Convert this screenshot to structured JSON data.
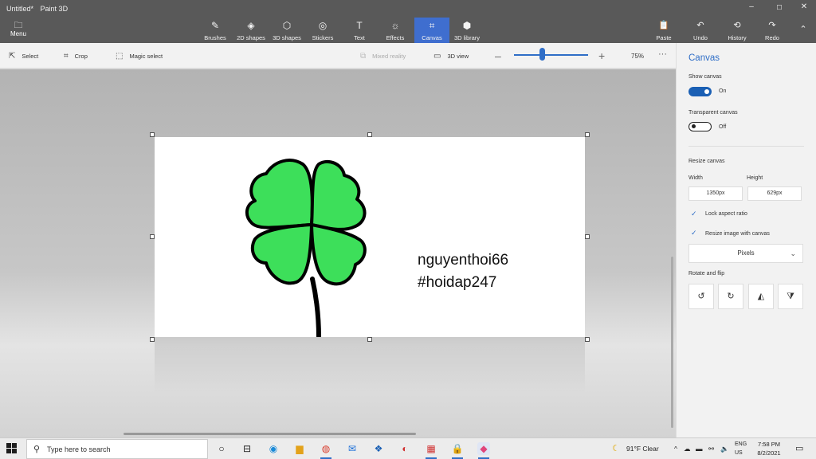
{
  "window": {
    "doc_title": "Untitled*",
    "app_name": "Paint 3D",
    "minimize_glyph": "–",
    "maximize_glyph": "☐",
    "close_glyph": "✕"
  },
  "ribbon": {
    "menu_label": "Menu",
    "tools": [
      {
        "label": "Brushes",
        "icon": "brush-icon",
        "glyph": "✎"
      },
      {
        "label": "2D shapes",
        "icon": "shapes-2d-icon",
        "glyph": "◈"
      },
      {
        "label": "3D shapes",
        "icon": "shapes-3d-icon",
        "glyph": "⬡"
      },
      {
        "label": "Stickers",
        "icon": "sticker-icon",
        "glyph": "◎"
      },
      {
        "label": "Text",
        "icon": "text-icon",
        "glyph": "T"
      },
      {
        "label": "Effects",
        "icon": "effects-icon",
        "glyph": "☼"
      },
      {
        "label": "Canvas",
        "icon": "canvas-icon",
        "glyph": "⌗"
      },
      {
        "label": "3D library",
        "icon": "library-3d-icon",
        "glyph": "⬢"
      }
    ],
    "active_tool": "Canvas",
    "right_tools": [
      {
        "label": "Paste",
        "icon": "paste-icon",
        "glyph": "📋"
      },
      {
        "label": "Undo",
        "icon": "undo-icon",
        "glyph": "↶"
      },
      {
        "label": "History",
        "icon": "history-icon",
        "glyph": "⟲"
      },
      {
        "label": "Redo",
        "icon": "redo-icon",
        "glyph": "↷"
      }
    ],
    "collapse_glyph": "⌃"
  },
  "subtoolbar": {
    "select_label": "Select",
    "crop_label": "Crop",
    "magic_select_label": "Magic select",
    "mixed_reality_label": "Mixed reality",
    "view_3d_label": "3D view",
    "zoom_value": "75%",
    "zoom_level": 0.38,
    "more_glyph": "···"
  },
  "canvas": {
    "line1": "nguyenthoi66",
    "line2": "#hoidap247",
    "clover_color": "#3ddf5a"
  },
  "panel": {
    "title": "Canvas",
    "show_canvas_label": "Show canvas",
    "show_canvas_state": "On",
    "transparent_canvas_label": "Transparent canvas",
    "transparent_canvas_state": "Off",
    "resize_label": "Resize canvas",
    "width_label": "Width",
    "height_label": "Height",
    "width_value": "1350px",
    "height_value": "629px",
    "lock_aspect_label": "Lock aspect ratio",
    "resize_with_canvas_label": "Resize image with canvas",
    "units_value": "Pixels",
    "rotate_flip_label": "Rotate and flip"
  },
  "taskbar": {
    "search_placeholder": "Type here to search",
    "weather": "91°F  Clear",
    "lang_line1": "ENG",
    "lang_line2": "US",
    "time": "7:58 PM",
    "date": "8/2/2021"
  },
  "colors": {
    "accent": "#2f6ec7",
    "active_tab": "#3f6ecf",
    "titlebar": "#595959"
  }
}
